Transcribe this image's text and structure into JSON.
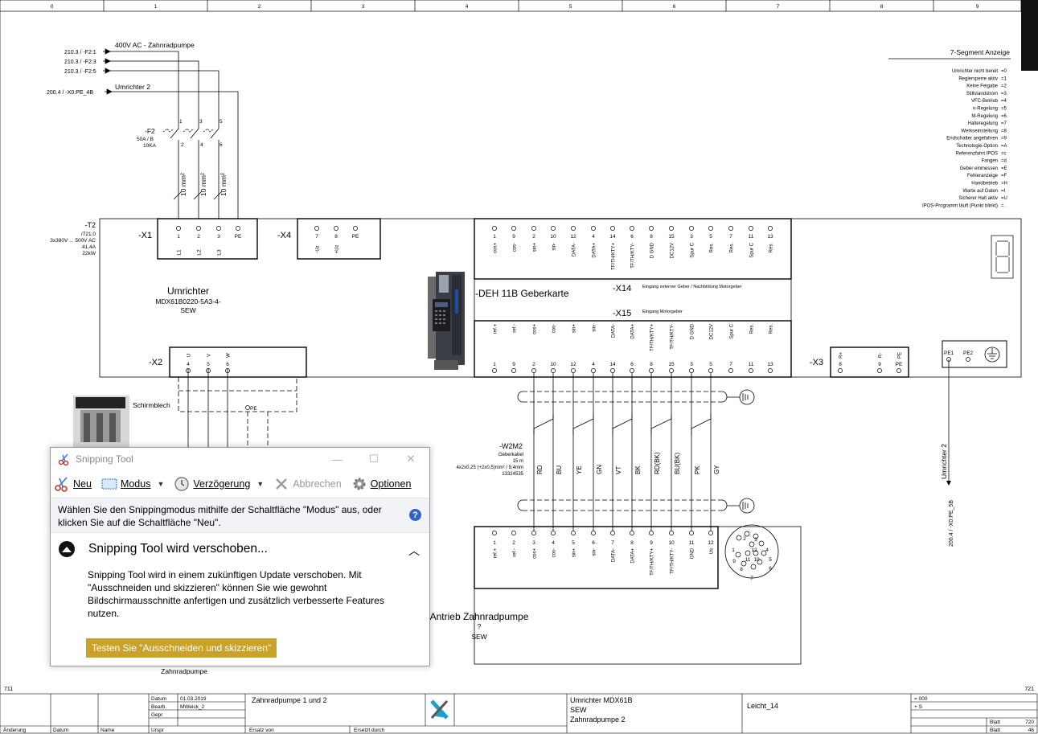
{
  "ruler": [
    "0",
    "1",
    "2",
    "3",
    "4",
    "5",
    "6",
    "7",
    "8",
    "9"
  ],
  "page_left": "711",
  "page_right": "721",
  "feeds": {
    "f1": "210.3 / -F2:1",
    "f2": "210.3 / -F2:3",
    "f3": "210.3 / -F2:5",
    "f4": "200.4 / -X0:PE_4B",
    "ac_label": "400V AC - Zahnradpumpe",
    "umr2_label": "Umrichter 2"
  },
  "breaker": {
    "name": "-F2",
    "rating1": "50A / B",
    "rating2": "10KA",
    "pins_top": [
      "1",
      "3",
      "5"
    ],
    "pins_bottom": [
      "2",
      "4",
      "6"
    ],
    "cable": "10 mm²"
  },
  "t2": {
    "name": "-T2",
    "ref": "/721.0",
    "spec1": "3x380V ... 500V AC",
    "spec2": "41,4A",
    "spec3": "22kW"
  },
  "x1": {
    "name": "-X1",
    "pins": [
      "1",
      "2",
      "3",
      "PE"
    ],
    "labels": [
      "L1",
      "L2",
      "L3",
      ""
    ]
  },
  "x4": {
    "name": "-X4",
    "pins": [
      "7",
      "8",
      "PE"
    ],
    "labels": [
      "-Uz",
      "+Uz",
      ""
    ]
  },
  "x14": {
    "pins": [
      "1",
      "9",
      "2",
      "10",
      "12",
      "4",
      "14",
      "6",
      "8",
      "15",
      "3",
      "5",
      "7",
      "11",
      "13"
    ],
    "labels": [
      "cos+",
      "cos-",
      "sin+",
      "sin-",
      "DATA-",
      "DATA+",
      "TF/TH/KTY+",
      "TF/TH/KTY-",
      "D GND",
      "DC12V",
      "Spur C",
      "Res.",
      "Res.",
      "Spur C",
      "Res."
    ]
  },
  "deh": {
    "name": "-DEH 11B Geberkarte",
    "x14": "-X14",
    "x14_desc": "Eingang externer Geber / Nachbildung Motorgeber",
    "x15": "-X15",
    "x15_desc": "Eingang Motorgeber"
  },
  "x15": {
    "labels": [
      "ref.+",
      "ref.-",
      "cos+",
      "cos-",
      "sin+",
      "sin-",
      "DATA-",
      "DATA+",
      "TF/TH/KTY+",
      "TF/TH/KTY-",
      "D GND",
      "DC12V",
      "Spur C",
      "Res.",
      "Res."
    ],
    "pins": [
      "1",
      "9",
      "2",
      "10",
      "12",
      "4",
      "14",
      "6",
      "8",
      "15",
      "3",
      "5",
      "7",
      "11",
      "13"
    ]
  },
  "umrichter": {
    "title": "Umrichter",
    "model": "MDX61B0220-5A3-4-",
    "maker": "SEW"
  },
  "x2": {
    "name": "-X2",
    "labels": [
      "U",
      "V",
      "W"
    ],
    "pins": [
      "4",
      "5",
      "6"
    ]
  },
  "x3": {
    "name": "-X3",
    "labels": [
      "R+",
      "R-",
      "PE"
    ],
    "pins": [
      "8",
      "9",
      "PE"
    ]
  },
  "pe_box": {
    "pins": [
      "PE1",
      "PE2"
    ]
  },
  "schirmblech": "Schirmblech",
  "pe_label": "PE",
  "cable": {
    "name": "-W2M2",
    "type": "Geberkabel",
    "length": "15 m",
    "spec": "4x2x0,25 (+2x0,5)mm² / 9,4mm",
    "part": "13324535",
    "colors": [
      "RD",
      "BU",
      "YE",
      "GN",
      "VT",
      "BK",
      "RD(BK)",
      "BU(BK)",
      "PK",
      "GY"
    ]
  },
  "motor_conn": {
    "pins": [
      "1",
      "2",
      "3",
      "4",
      "5",
      "6",
      "7",
      "8",
      "9",
      "10",
      "11",
      "12"
    ],
    "labels": [
      "ref.+",
      "ref.-",
      "cos+",
      "cos-",
      "sin+",
      "sin-",
      "DATA-",
      "DATA+",
      "TF/TH/KTY+",
      "TF/TH/KTY-",
      "GND",
      "Us"
    ],
    "title": "Antrieb Zahnradpumpe",
    "q": "?",
    "maker": "SEW"
  },
  "plug_pins": [
    "1",
    "2",
    "3",
    "4",
    "5",
    "6",
    "7",
    "8",
    "9",
    "10",
    "11",
    "12"
  ],
  "zahnradpumpe": "Zahnradpumpe",
  "umr2_vertical": "Umrichter 2",
  "umr2_ref": "200.4 / -X0:PE_5B",
  "seg": {
    "title": "7-Segment Anzeige",
    "items": [
      [
        "Umrichter nicht bereit",
        "=0"
      ],
      [
        "Reglersperre aktiv",
        "=1"
      ],
      [
        "Keine Feigabe",
        "=2"
      ],
      [
        "Stillstandstrom",
        "=3"
      ],
      [
        "VFC-Betrieb",
        "=4"
      ],
      [
        "n-Regelung",
        "=5"
      ],
      [
        "M-Regelung",
        "=6"
      ],
      [
        "Halteregelung",
        "=7"
      ],
      [
        "Werkseinstellung",
        "=8"
      ],
      [
        "Endschalter angefahren",
        "=9"
      ],
      [
        "Technologie-Option",
        "=A"
      ],
      [
        "Referenzfahrt IPOS",
        "=c"
      ],
      [
        "Fangen",
        "=d"
      ],
      [
        "Geber einmessen",
        "=E"
      ],
      [
        "Fehleranzeige",
        "=F"
      ],
      [
        "Handbetrieb",
        "=H"
      ],
      [
        "Warte auf Daten",
        "=t"
      ],
      [
        "Sicherer Halt aktiv",
        "=U"
      ],
      [
        "IPOS-Programm läuft (Punkt blinkt)",
        "= ."
      ]
    ]
  },
  "titleblock": {
    "datum_l": "Datum",
    "datum_v": "01.03.2019",
    "bearb_l": "Bearb.",
    "bearb_v": "MWeick_2",
    "gepr_l": "Gepr",
    "aend_l": "Änderung",
    "datum2_l": "Datum",
    "name_l": "Name",
    "urspr_l": "Urspr",
    "ersatz_von": "Ersatz von",
    "ersetzt_durch": "Ersetzt durch",
    "project": "Zahnradpumpe 1 und 2",
    "desc1": "Umrichter MDX61B",
    "desc2": "SEW",
    "desc3": "Zahnradpumpe 2",
    "location": "Leicht_14",
    "eq": "= 000",
    "plus": "+ S",
    "blatt_l": "Blatt",
    "blatt_v": "720",
    "blatt2_l": "Blatt",
    "blatt2_v": "46"
  },
  "snipping": {
    "title": "Snipping Tool",
    "new": "Neu",
    "mode": "Modus",
    "delay": "Verzögerung",
    "cancel": "Abbrechen",
    "options": "Optionen",
    "hint": "Wählen Sie den Snippingmodus mithilfe der Schaltfläche \"Modus\" aus, oder klicken Sie auf die Schaltfläche \"Neu\".",
    "notice_title": "Snipping Tool wird verschoben...",
    "notice_body": "Snipping Tool wird in einem zukünftigen Update verschoben. Mit \"Ausschneiden und skizzieren\" können Sie wie gewohnt Bildschirmausschnitte anfertigen und zusätzlich verbesserte Features nutzen.",
    "try_button": "Testen Sie \"Ausschneiden und skizzieren\""
  }
}
